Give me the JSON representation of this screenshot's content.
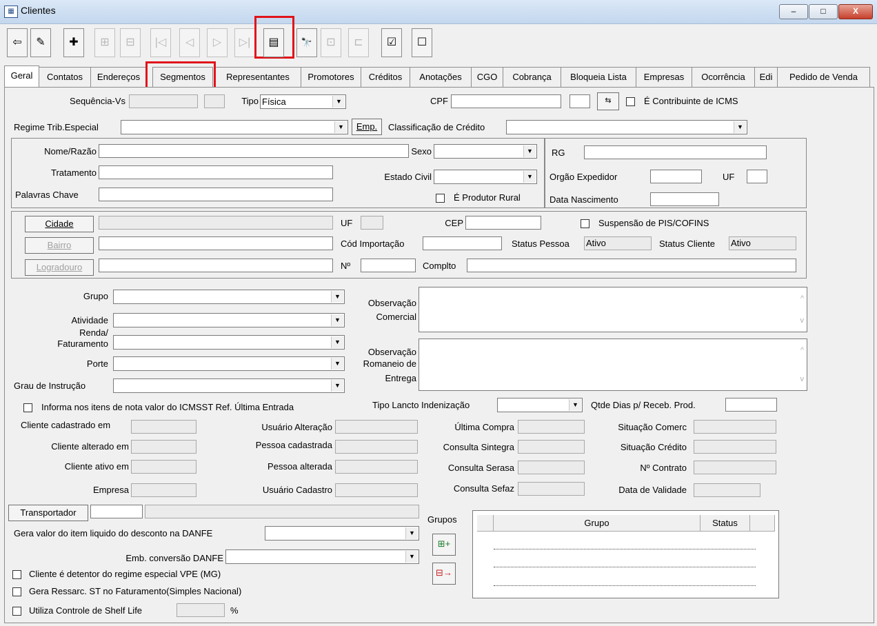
{
  "window": {
    "title": "Clientes",
    "minimize": "–",
    "maximize": "□",
    "close": "X",
    "app_icon": "form-icon"
  },
  "toolbar": {
    "buttons": [
      {
        "icon": "exit-icon",
        "glyph": "⇦"
      },
      {
        "icon": "eraser-icon",
        "glyph": "✎"
      },
      {
        "icon": "add-record-icon",
        "glyph": "✚"
      },
      {
        "icon": "insert-icon",
        "glyph": "⊞"
      },
      {
        "icon": "delete-icon",
        "glyph": "⊟"
      },
      {
        "icon": "first-record-icon",
        "glyph": "|◁"
      },
      {
        "icon": "previous-record-icon",
        "glyph": "◁"
      },
      {
        "icon": "next-record-icon",
        "glyph": "▷"
      },
      {
        "icon": "last-record-icon",
        "glyph": "▷|"
      },
      {
        "icon": "list-view-icon",
        "glyph": "▤"
      },
      {
        "icon": "binoculars-icon",
        "glyph": "👓"
      },
      {
        "icon": "edit-grid-icon",
        "glyph": "⊡"
      },
      {
        "icon": "export-grid-icon",
        "glyph": "⊏"
      },
      {
        "icon": "checklist-icon",
        "glyph": "☑"
      },
      {
        "icon": "uncheck-list-icon",
        "glyph": "☐"
      }
    ]
  },
  "tabs": [
    "Geral",
    "Contatos",
    "Endereços",
    "Segmentos",
    "Representantes",
    "Promotores",
    "Créditos",
    "Anotações",
    "CGO",
    "Cobrança",
    "Bloqueia Lista",
    "Empresas",
    "Ocorrência",
    "Edi",
    "Pedido de Venda"
  ],
  "form": {
    "sequencia_label": "Sequência-Vs",
    "tipo_label": "Tipo",
    "tipo_value": "Física",
    "cpf_label": "CPF",
    "contribuinte_label": "É Contribuinte de ICMS",
    "regime_label": "Regime Trib.Especial",
    "emp_button": "Emp.",
    "classificacao_label": "Classificação de Crédito",
    "nome_label": "Nome/Razão",
    "sexo_label": "Sexo",
    "rg_label": "RG",
    "tratamento_label": "Tratamento",
    "estado_civil_label": "Estado Civil",
    "orgao_label": "Orgão Expedidor",
    "uf_label": "UF",
    "palavras_label": "Palavras Chave",
    "produtor_label": "É Produtor Rural",
    "nascimento_label": "Data Nascimento",
    "cidade_button": "Cidade",
    "cep_label": "CEP",
    "pis_label": "Suspensão de PIS/COFINS",
    "bairro_button": "Bairro",
    "cod_import_label": "Cód Importação",
    "status_pessoa_label": "Status Pessoa",
    "status_pessoa_value": "Ativo",
    "status_cliente_label": "Status Cliente",
    "status_cliente_value": "Ativo",
    "logradouro_button": "Logradouro",
    "numero_label": "Nº",
    "complto_label": "Complto",
    "grupo_label": "Grupo",
    "atividade_label": "Atividade",
    "renda_label_1": "Renda/",
    "renda_label_2": "Faturamento",
    "porte_label": "Porte",
    "grau_label": "Grau de Instrução",
    "obs_comercial_1": "Observação",
    "obs_comercial_2": "Comercial",
    "obs_romaneio_1": "Observação",
    "obs_romaneio_2": "Romaneio de",
    "obs_romaneio_3": "Entrega",
    "icmsst_label": "Informa nos itens de nota valor do ICMSST Ref. Última Entrada",
    "tipo_lancto_label": "Tipo Lancto Indenização",
    "qtde_dias_label": "Qtde Dias p/ Receb. Prod.",
    "cliente_cad_label": "Cliente cadastrado em",
    "usuario_alt_label": "Usuário Alteração",
    "ultima_compra_label": "Última Compra",
    "situacao_comerc_label": "Situação Comerc",
    "cliente_alt_label": "Cliente alterado em",
    "pessoa_cad_label": "Pessoa cadastrada",
    "sintegra_label": "Consulta Sintegra",
    "situacao_credito_label": "Situação Crédito",
    "cliente_ativo_label": "Cliente ativo em",
    "pessoa_alt_label": "Pessoa alterada",
    "serasa_label": "Consulta Serasa",
    "contrato_label": "Nº Contrato",
    "empresa_label": "Empresa",
    "usuario_cad_label": "Usuário Cadastro",
    "sefaz_label": "Consulta Sefaz",
    "validade_label": "Data de Validade",
    "transportador_button": "Transportador",
    "gera_valor_label": "Gera valor do item liquido do desconto na DANFE",
    "emb_conversao_label": "Emb. conversão DANFE",
    "vpe_label": "Cliente é detentor do regime especial VPE (MG)",
    "ressarc_label": "Gera Ressarc. ST no Faturamento(Simples Nacional)",
    "shelf_label": "Utiliza Controle de Shelf Life",
    "percent_label": "%",
    "grupos_label": "Grupos",
    "grid_col_grupo": "Grupo",
    "grid_col_status": "Status"
  }
}
